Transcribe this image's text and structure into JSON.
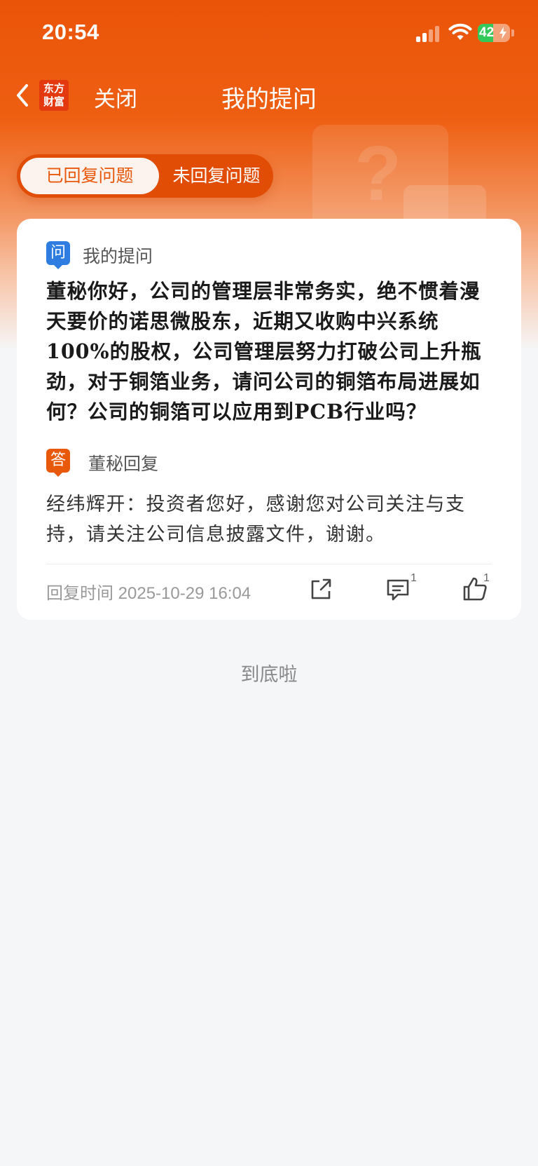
{
  "status_bar": {
    "time": "20:54",
    "battery": "42"
  },
  "nav": {
    "logo_line1": "东方",
    "logo_line2": "财富",
    "close_label": "关闭",
    "title": "我的提问"
  },
  "tabs": [
    {
      "label": "已回复问题",
      "active": true
    },
    {
      "label": "未回复问题",
      "active": false
    }
  ],
  "card": {
    "question_badge": "问",
    "question_section": "我的提问",
    "question_text": "董秘你好，公司的管理层非常务实，绝不惯着漫天要价的诺思微股东，近期又收购中兴系统100%的股权，公司管理层努力打破公司上升瓶劲，对于铜箔业务，请问公司的铜箔布局进展如何？公司的铜箔可以应用到PCB行业吗？",
    "answer_badge": "答",
    "answer_section": "董秘回复",
    "answer_text": "经纬辉开：投资者您好，感谢您对公司关注与支持，请关注公司信息披露文件，谢谢。",
    "reply_time": "回复时间 2025-10-29 16:04",
    "comment_count": "1",
    "like_count": "1",
    "icons": [
      "share-icon",
      "comment-icon",
      "like-icon"
    ]
  },
  "footer": {
    "end_text": "到底啦"
  },
  "colors": {
    "brand_orange": "#ea5409",
    "question_blue": "#2f7de1",
    "answer_orange": "#e8590c"
  }
}
